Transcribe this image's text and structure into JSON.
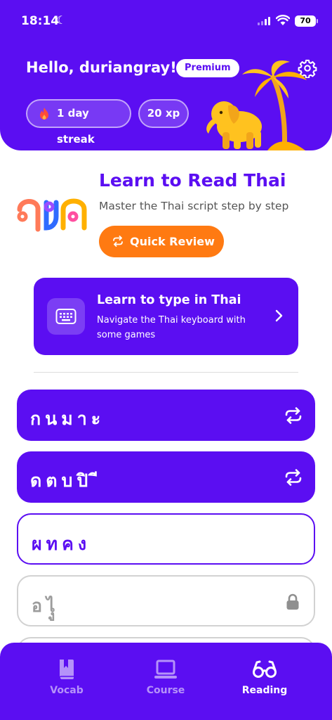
{
  "status_bar": {
    "time": "18:14",
    "battery": "70"
  },
  "header": {
    "greeting": "Hello, duriangray!",
    "badge": "Premium",
    "streak": "1 day streak",
    "xp": "20 xp"
  },
  "course": {
    "title": "Learn to Read Thai",
    "subtitle": "Master the Thai script step by step",
    "quick_review": "Quick Review"
  },
  "type_card": {
    "title": "Learn to type in Thai",
    "description": "Navigate the Thai keyboard with some games"
  },
  "lessons": [
    {
      "text": "กนมาะ",
      "state": "completed"
    },
    {
      "text": "ดตบปิ ี",
      "state": "completed"
    },
    {
      "text": "ผทคง",
      "state": "current"
    },
    {
      "text": "อไุู",
      "state": "locked"
    }
  ],
  "nav": {
    "items": [
      {
        "label": "Vocab",
        "icon": "bookmark-book-icon",
        "active": false
      },
      {
        "label": "Course",
        "icon": "laptop-icon",
        "active": false
      },
      {
        "label": "Reading",
        "icon": "glasses-icon",
        "active": true
      }
    ]
  },
  "colors": {
    "primary": "#5b0ef2",
    "accent": "#ff7a12"
  }
}
